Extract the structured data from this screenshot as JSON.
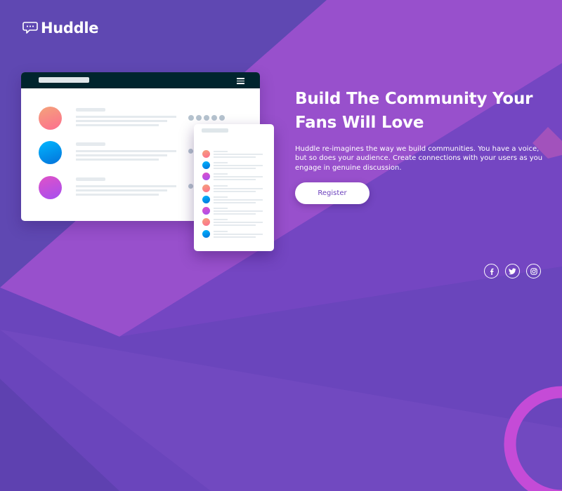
{
  "brand": {
    "name": "Huddle"
  },
  "hero": {
    "headline": "Build The Community Your Fans Will Love",
    "description": "Huddle re-imagines the way we build communities. You have a voice, but so does your audience. Create connections with your users as you engage in genuine discussion.",
    "cta_label": "Register"
  },
  "socials": [
    {
      "icon": "facebook-icon"
    },
    {
      "icon": "twitter-icon"
    },
    {
      "icon": "instagram-icon"
    }
  ],
  "colors": {
    "background": "#6a3fbc",
    "mockup_bar": "#00252e",
    "button_text": "#6a3fbc"
  }
}
